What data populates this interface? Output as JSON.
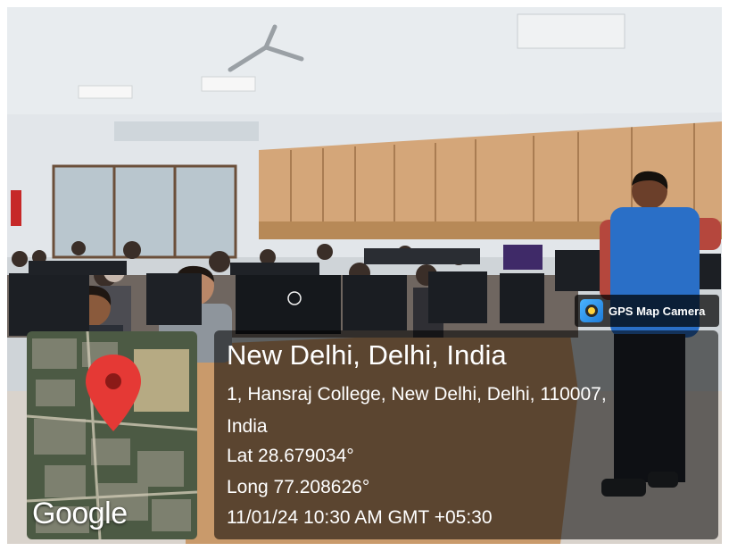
{
  "badge": {
    "label": "GPS Map Camera",
    "icon": "gps-map-camera-app-icon"
  },
  "location": {
    "city": "New Delhi, Delhi, India",
    "address_line1": "1, Hansraj College, New Delhi, Delhi, 110007,",
    "address_line2": "India",
    "lat": "Lat 28.679034°",
    "long": "Long 77.208626°",
    "datetime": "11/01/24 10:30 AM GMT +05:30"
  },
  "map": {
    "brand": "Google",
    "pin_icon": "location-pin-icon",
    "pin_color": "#e53935"
  },
  "colors": {
    "panel": "#000000",
    "vest": "#2a6fc7",
    "wall_cabinets": "#d4a679"
  }
}
